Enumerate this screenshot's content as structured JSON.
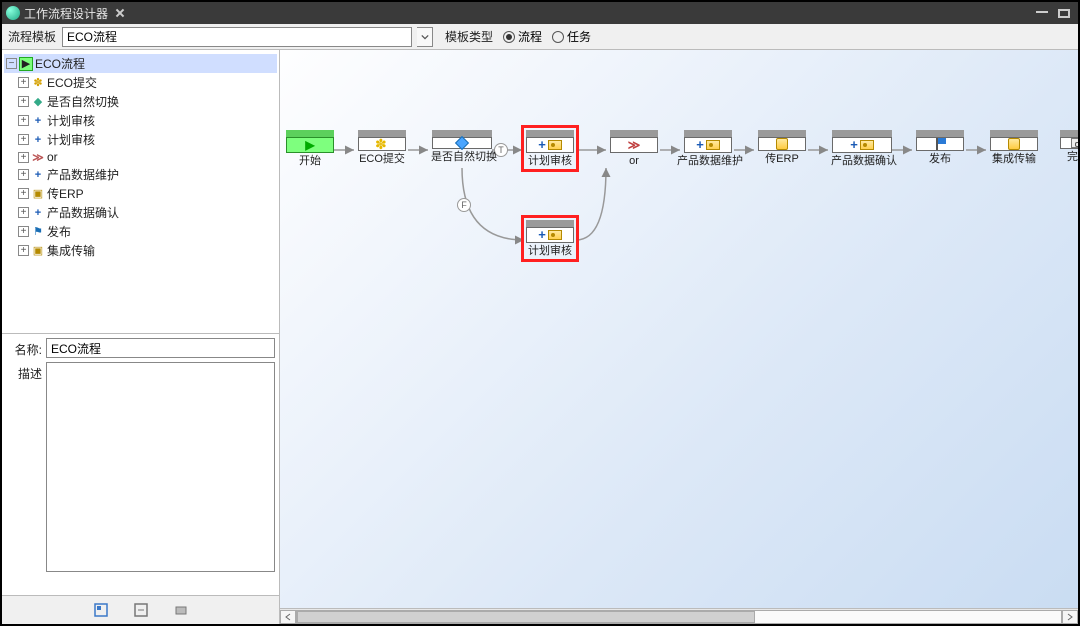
{
  "titlebar": {
    "title": "工作流程设计器"
  },
  "toolbar": {
    "template_label": "流程模板",
    "template_value": "ECO流程",
    "type_label": "模板类型",
    "radio_flow": "流程",
    "radio_task": "任务"
  },
  "tree": {
    "root": "ECO流程",
    "items": [
      {
        "label": "ECO提交",
        "icon": "sun"
      },
      {
        "label": "是否自然切换",
        "icon": "diamond"
      },
      {
        "label": "计划审核",
        "icon": "plus"
      },
      {
        "label": "计划审核",
        "icon": "plus"
      },
      {
        "label": "or",
        "icon": "gt"
      },
      {
        "label": "产品数据维护",
        "icon": "plus"
      },
      {
        "label": "传ERP",
        "icon": "db"
      },
      {
        "label": "产品数据确认",
        "icon": "plus"
      },
      {
        "label": "发布",
        "icon": "flag"
      },
      {
        "label": "集成传输",
        "icon": "db"
      }
    ]
  },
  "props": {
    "name_label": "名称:",
    "name_value": "ECO流程",
    "desc_label": "描述",
    "desc_value": ""
  },
  "nodes": {
    "start": "开始",
    "eco_submit": "ECO提交",
    "is_natural": "是否自然切换",
    "plan_review": "计划审核",
    "plan_review2": "计划审核",
    "or_label": "or",
    "product_maint": "产品数据维护",
    "to_erp": "传ERP",
    "product_confirm": "产品数据确认",
    "publish": "发布",
    "integration": "集成传输",
    "finish": "完成"
  },
  "branch": {
    "t": "T",
    "f": "F"
  }
}
